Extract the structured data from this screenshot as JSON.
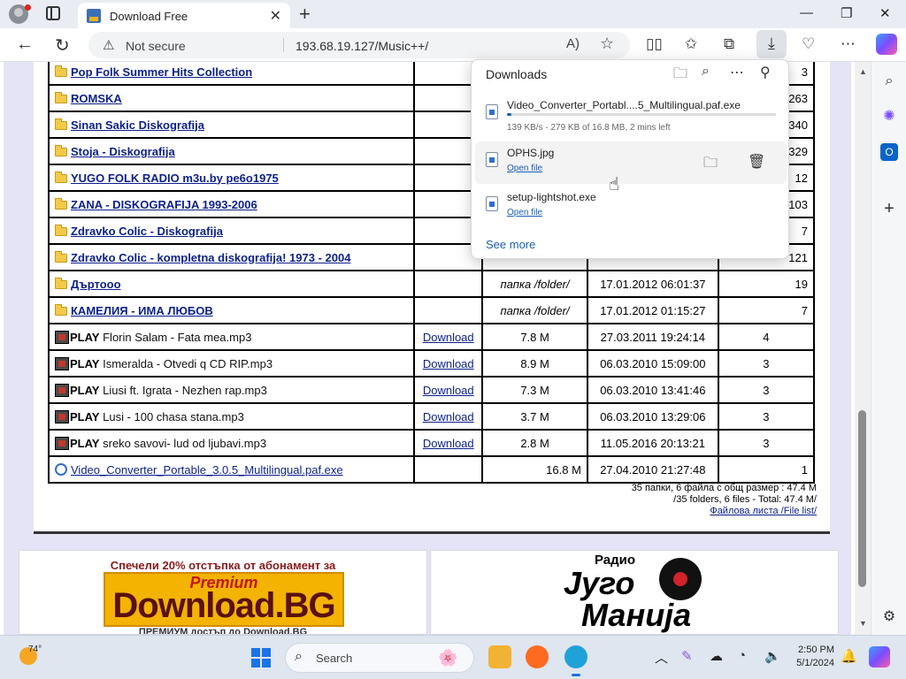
{
  "browser": {
    "tab_title": "Download Free",
    "not_secure": "Not secure",
    "url": "193.68.19.127/Music++/"
  },
  "listing": {
    "folders": [
      {
        "name": "Pop Folk Summer Hits Collection",
        "size": "",
        "date": "",
        "count": "3"
      },
      {
        "name": "ROMSKA",
        "size": "",
        "date": "",
        "count": "263"
      },
      {
        "name": "Sinan Sakic Diskografija",
        "size": "",
        "date": "",
        "count": "340"
      },
      {
        "name": "Stoja - Diskografija",
        "size": "",
        "date": "",
        "count": "329"
      },
      {
        "name": "YUGO FOLK RADIO m3u.by ре6о1975",
        "size": "",
        "date": "",
        "count": "12"
      },
      {
        "name": "ZANA - DISKOGRAFIJA 1993-2006",
        "size": "",
        "date": "",
        "count": "103"
      },
      {
        "name": "Zdravko Colic - Diskografija",
        "size": "",
        "date": "",
        "count": "7"
      },
      {
        "name": "Zdravko Colic - kompletna diskografija! 1973 - 2004",
        "size": "",
        "date": "",
        "count": "121"
      },
      {
        "name": "Дъртооо",
        "size": "папка /folder/",
        "date": "17.01.2012 06:01:37",
        "count": "19"
      },
      {
        "name": "КАМЕЛИЯ - ИМА ЛЮБОВ",
        "size": "папка /folder/",
        "date": "17.01.2012 01:15:27",
        "count": "7"
      }
    ],
    "play_label": "PLAY",
    "download_label": "Download",
    "files": [
      {
        "name": "Florin Salam - Fata mea.mp3",
        "size": "7.8 M",
        "date": "27.03.2011 19:24:14",
        "count": "4"
      },
      {
        "name": "Ismeralda - Otvedi q CD RIP.mp3",
        "size": "8.9 M",
        "date": "06.03.2010 15:09:00",
        "count": "3"
      },
      {
        "name": "Liusi ft. Igrata - Nezhen rap.mp3",
        "size": "7.3 M",
        "date": "06.03.2010 13:41:46",
        "count": "3"
      },
      {
        "name": "Lusi - 100 chasa stana.mp3",
        "size": "3.7 M",
        "date": "06.03.2010 13:29:06",
        "count": "3"
      },
      {
        "name": "sreko savovi- lud od ljubavi.mp3",
        "size": "2.8 M",
        "date": "11.05.2016 20:13:21",
        "count": "3"
      }
    ],
    "exe": {
      "name": "Video_Converter_Portable_3.0.5_Multilingual.paf.exe",
      "size": "16.8 M",
      "date": "27.04.2010 21:27:48",
      "count": "1"
    },
    "summary_bg": "35 папки, 6 файла с общ размер : 47.4 M",
    "summary_en": "/35 folders, 6 files - Total: 47.4 M/",
    "file_list_link": "Файлова листа /File list/"
  },
  "ads": {
    "left_headline": "Спечели 20% отстъпка от абонамент за",
    "left_premium": "Premium",
    "left_big": "Download.BG",
    "left_bottom": "ПРЕМИУМ достъп до Download.BG",
    "right_radio": "Радио",
    "right_word1": "Југо",
    "right_word2": "Манија"
  },
  "downloads": {
    "title": "Downloads",
    "items": [
      {
        "name": "Video_Converter_Portabl....5_Multilingual.paf.exe",
        "status": "139 KB/s - 279 KB of 16.8 MB, 2 mins left",
        "progress": 0.017
      },
      {
        "name": "OPHS.jpg",
        "action": "Open file"
      },
      {
        "name": "setup-lightshot.exe",
        "action": "Open file"
      }
    ],
    "see_more": "See more"
  },
  "taskbar": {
    "temperature": "74°",
    "search_label": "Search",
    "time": "2:50 PM",
    "date": "5/1/2024"
  },
  "colors": {
    "link": "#0b1f8c",
    "accent": "#1a5fb4",
    "page_bg": "#e4e4f6"
  }
}
